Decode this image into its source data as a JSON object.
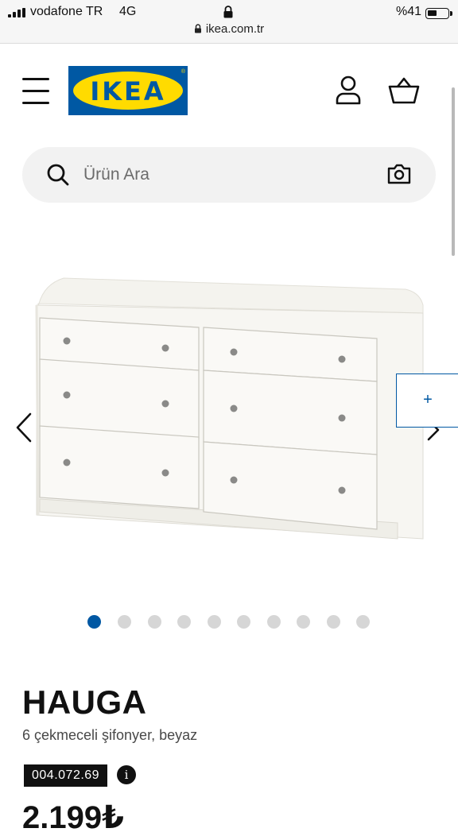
{
  "status_bar": {
    "carrier": "vodafone TR",
    "network": "4G",
    "battery_percent": "%41",
    "url": "ikea.com.tr",
    "signal_icon": "signal-bars-icon",
    "lock_icon": "lock-icon",
    "battery_icon": "battery-icon"
  },
  "header": {
    "logo_text": "IKEA",
    "menu_icon": "hamburger-menu-icon",
    "user_icon": "user-account-icon",
    "cart_icon": "shopping-basket-icon"
  },
  "search": {
    "placeholder": "Ürün Ara",
    "search_icon": "magnifier-icon",
    "camera_icon": "camera-icon"
  },
  "gallery": {
    "image_count": 10,
    "active_index": 0,
    "zoom_button": "+",
    "prev_icon": "chevron-left-icon",
    "next_icon": "chevron-right-icon"
  },
  "product": {
    "name": "HAUGA",
    "description": "6 çekmeceli şifonyer, beyaz",
    "article_number": "004.072.69",
    "info_label": "i",
    "price_partial": "2.199₺"
  },
  "colors": {
    "brand_blue": "#0058a3",
    "brand_yellow": "#ffdb00"
  }
}
